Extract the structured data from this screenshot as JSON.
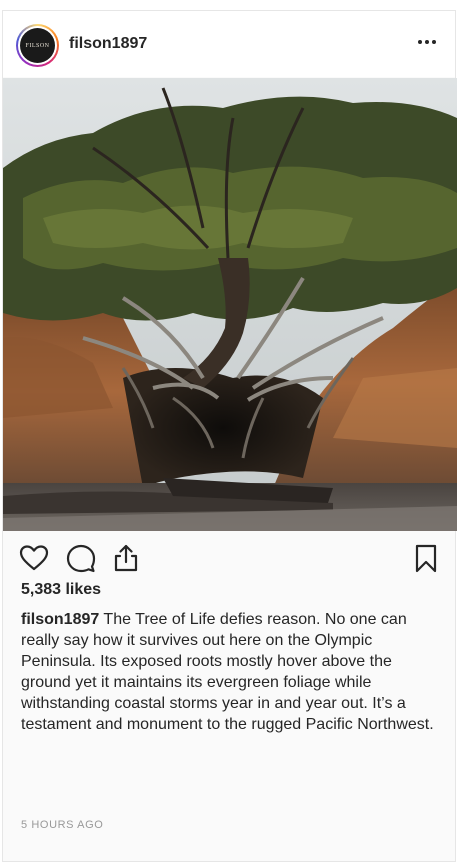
{
  "post": {
    "username": "filson1897",
    "avatar_text": "FILSON",
    "likes": "5,383 likes",
    "caption_user": "filson1897",
    "caption_text": " The Tree of Life defies reason. No one can really say how it survives out here on the Olympic Peninsula. Its exposed roots mostly hover above the ground yet it maintains its evergreen foliage while withstanding coastal storms year in and year out. It’s a testament and monument to the rugged Pacific Northwest.",
    "timestamp": "5 HOURS AGO"
  },
  "icons": {
    "more": "more-options-icon",
    "like": "heart-icon",
    "comment": "comment-icon",
    "share": "share-icon",
    "save": "bookmark-icon"
  },
  "colors": {
    "text": "#262626",
    "muted": "#999999",
    "border": "#e6e6e6"
  }
}
